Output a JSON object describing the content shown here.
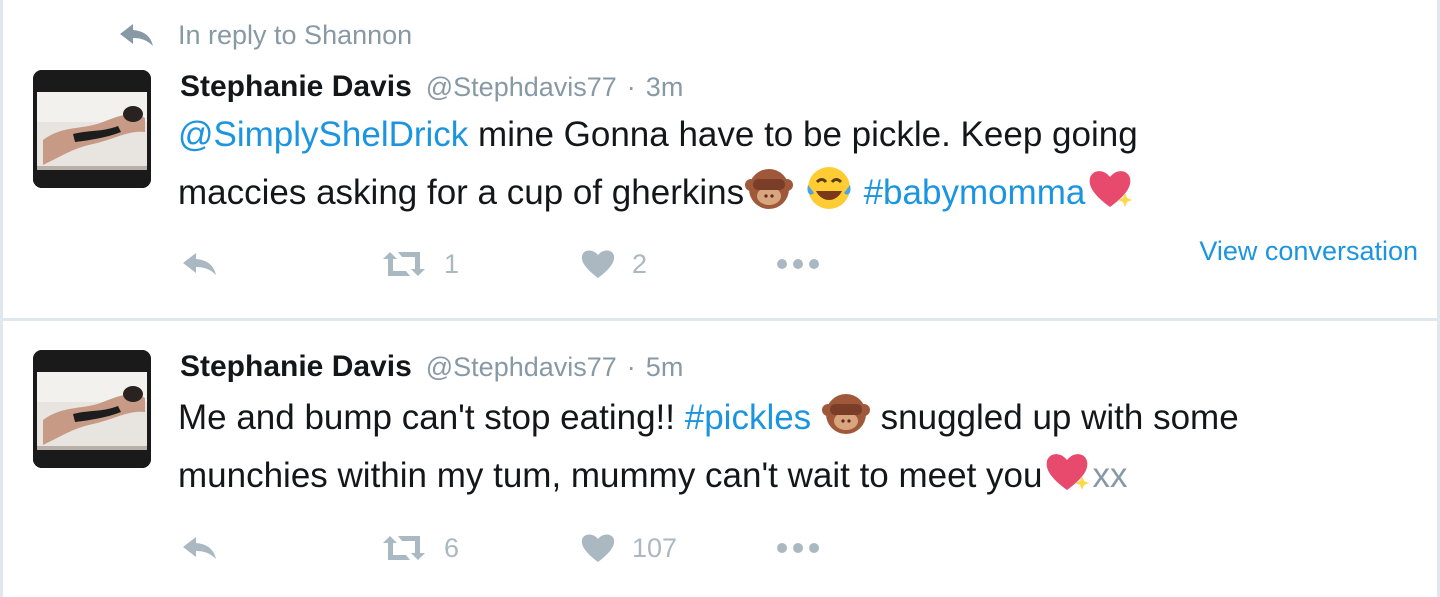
{
  "reply_context": {
    "text": "In reply to Shannon",
    "icon": "reply-icon"
  },
  "tweets": [
    {
      "fullname": "Stephanie Davis",
      "username": "@Stephdavis77",
      "separator": "·",
      "time": "3m",
      "mention": "@SimplyShelDrick",
      "text_1": "mine Gonna have to be pickle. Keep going",
      "text_2": "maccies asking for a cup of gherkins",
      "hashtag": "#babymomma",
      "emojis": [
        "see-no-evil-monkey-emoji",
        "face-with-tears-of-joy-emoji",
        "sparkling-heart-emoji"
      ],
      "retweets": "1",
      "likes": "2",
      "view_conversation": "View conversation"
    },
    {
      "fullname": "Stephanie Davis",
      "username": "@Stephdavis77",
      "separator": "·",
      "time": "5m",
      "text_1": "Me and bump can't stop eating!!",
      "hashtag": "#pickles",
      "text_2": "snuggled up with some",
      "text_3": "munchies within my tum, mummy can't wait to meet you",
      "text_4": "xx",
      "emojis": [
        "see-no-evil-monkey-emoji",
        "sparkling-heart-emoji"
      ],
      "retweets": "6",
      "likes": "107"
    }
  ],
  "colors": {
    "link": "#1b95e0",
    "muted": "#8899a6",
    "action": "#aab8c2",
    "text": "#14171a",
    "divider": "#e1e8ed"
  }
}
